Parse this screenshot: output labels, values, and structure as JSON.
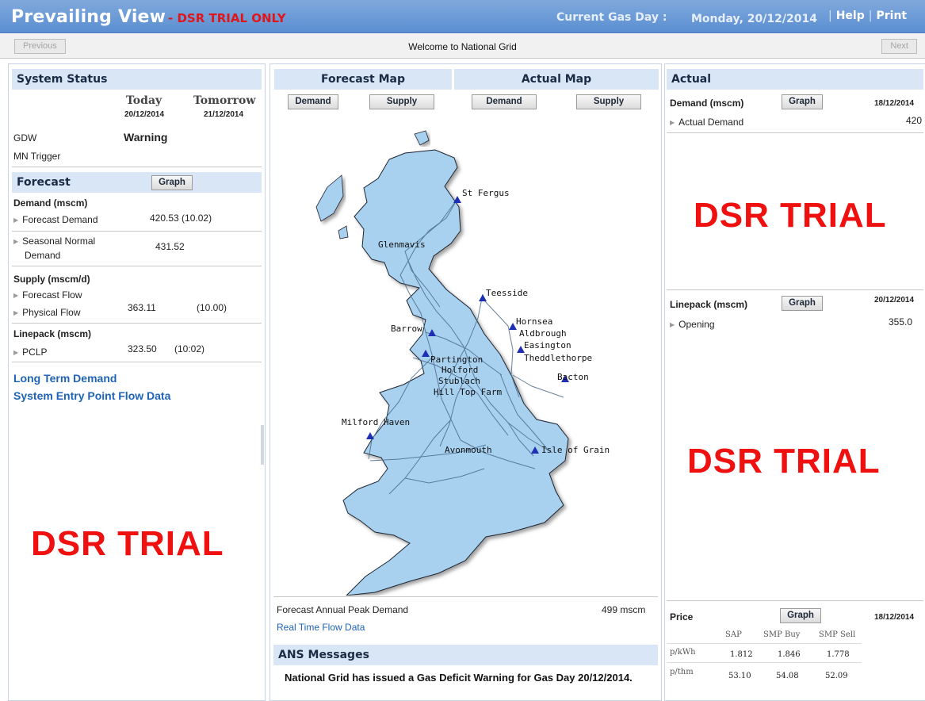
{
  "header": {
    "title": "Prevailing View",
    "trial_note": "- DSR TRIAL ONLY",
    "gas_day_label": "Current Gas Day :",
    "gas_day_value": "Monday, 20/12/2014",
    "help": "Help",
    "print": "Print"
  },
  "nav": {
    "previous": "Previous",
    "next": "Next",
    "welcome": "Welcome to National Grid"
  },
  "system_status": {
    "title": "System Status",
    "today_label": "Today",
    "today_date": "20/12/2014",
    "tomorrow_label": "Tomorrow",
    "tomorrow_date": "21/12/2014",
    "gdw_label": "GDW",
    "gdw_today": "Warning",
    "mn_trigger_label": "MN Trigger"
  },
  "forecast": {
    "title": "Forecast",
    "graph": "Graph",
    "demand_heading": "Demand (mscm)",
    "forecast_demand_label": "Forecast Demand",
    "forecast_demand_value": "420.53 (10.02)",
    "seasonal_label_1": "Seasonal Normal",
    "seasonal_label_2": "Demand",
    "seasonal_value": "431.52",
    "supply_heading": "Supply (mscm/d)",
    "forecast_flow_label": "Forecast Flow",
    "physical_flow_label": "Physical Flow",
    "physical_flow_value": "363.11",
    "physical_flow_time": "(10.00)",
    "linepack_heading": "Linepack (mscm)",
    "pclp_label": "PCLP",
    "pclp_value": "323.50",
    "pclp_time": "(10:02)",
    "long_term_link": "Long Term Demand",
    "entry_point_link": "System Entry Point Flow Data",
    "dsr": "DSR TRIAL"
  },
  "maps": {
    "forecast_map": "Forecast Map",
    "actual_map": "Actual Map",
    "demand": "Demand",
    "supply": "Supply",
    "sites": {
      "st_fergus": "St Fergus",
      "glenmavis": "Glenmavis",
      "teesside": "Teesside",
      "barrow": "Barrow",
      "hornsea": "Hornsea",
      "aldbrough": "Aldbrough",
      "easington": "Easington",
      "theddlethorpe": "Theddlethorpe",
      "partington": "Partington",
      "holford": "Holford",
      "stublach": "Stublach",
      "hill_top_farm": "Hill Top Farm",
      "bacton": "Bacton",
      "milford_haven": "Milford Haven",
      "avonmouth": "Avonmouth",
      "isle_of_grain": "Isle of Grain"
    },
    "peak_label": "Forecast Annual Peak Demand",
    "peak_value": "499 mscm",
    "realtime_link": "Real Time Flow Data",
    "ans_title": "ANS Messages",
    "ans_message": "National Grid has issued a Gas Deficit Warning for Gas Day 20/12/2014."
  },
  "actual": {
    "title": "Actual",
    "demand_heading": "Demand (mscm)",
    "graph": "Graph",
    "demand_date": "18/12/2014",
    "actual_demand_label": "Actual Demand",
    "actual_demand_value": "420",
    "dsr_1": "DSR TRIAL",
    "linepack_heading": "Linepack (mscm)",
    "linepack_date": "20/12/2014",
    "opening_label": "Opening",
    "opening_value": "355.0",
    "dsr_2": "DSR TRIAL",
    "price_heading": "Price",
    "price_date": "18/12/2014",
    "price_cols": [
      "SAP",
      "SMP Buy",
      "SMP Sell"
    ],
    "price_rows": [
      {
        "unit": "p/kWh",
        "values": [
          "1.812",
          "1.846",
          "1.778"
        ]
      },
      {
        "unit": "p/thm",
        "values": [
          "53.10",
          "54.08",
          "52.09"
        ]
      }
    ]
  },
  "colors": {
    "header_bar": "#5b8ed1",
    "section_head": "#d8e6f6",
    "map_fill": "#a8d0ef",
    "trial_red": "#ef1010",
    "link_blue": "#1f63b7"
  }
}
